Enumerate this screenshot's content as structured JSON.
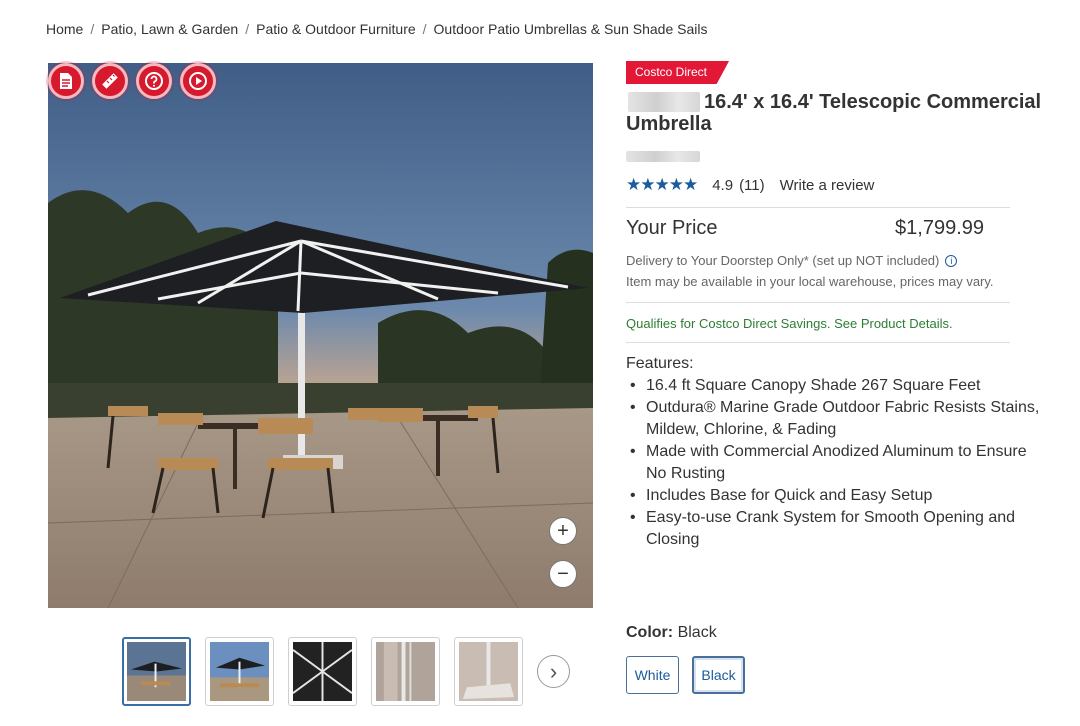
{
  "breadcrumb": {
    "items": [
      "Home",
      "Patio, Lawn & Garden",
      "Patio & Outdoor Furniture",
      "Outdoor Patio Umbrellas & Sun Shade Sails"
    ],
    "separator": "/"
  },
  "gallery": {
    "tool_icons": [
      "document-icon",
      "ruler-icon",
      "question-icon",
      "play-icon"
    ],
    "zoom_in": "+",
    "zoom_out": "−",
    "thumbnail_count": 5,
    "next": "›"
  },
  "product": {
    "badge": "Costco Direct",
    "title": "16.4' x 16.4' Telescopic Commercial Umbrella",
    "rating": {
      "stars_value": 4.9,
      "stars_display": "★★★★★",
      "score": "4.9",
      "count": "(11)",
      "write_review": "Write a review"
    },
    "price": {
      "label": "Your Price",
      "value": "$1,799.99"
    },
    "delivery": "Delivery to Your Doorstep Only* (set up NOT included)",
    "warehouse_note": "Item may be available in your local warehouse, prices may vary.",
    "savings": "Qualifies for Costco Direct Savings. See Product Details.",
    "features_label": "Features:",
    "features": [
      "16.4 ft Square Canopy Shade 267 Square Feet",
      "Outdura® Marine Grade Outdoor Fabric Resists Stains, Mildew, Chlorine, & Fading",
      "Made with Commercial Anodized Aluminum to Ensure No Rusting",
      "Includes Base for Quick and Easy Setup",
      "Easy-to-use Crank System for Smooth Opening and Closing"
    ],
    "color": {
      "label": "Color:",
      "selected": "Black",
      "options": [
        "White",
        "Black"
      ]
    }
  },
  "colors": {
    "brand_red": "#e31837",
    "link_blue": "#1c5b9c",
    "savings_green": "#2e7d32"
  }
}
